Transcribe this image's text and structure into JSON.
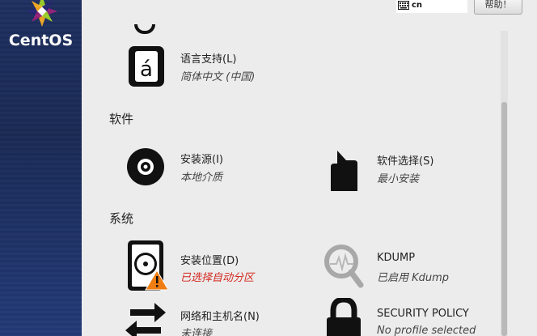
{
  "brand": {
    "name": "CentOS"
  },
  "topbar": {
    "keyboard_layout": "cn",
    "help_label": "帮助！"
  },
  "sections": {
    "software": "软件",
    "system": "系统"
  },
  "spokes": {
    "language": {
      "title": "语言支持(L)",
      "status": "简体中文 (中国)",
      "icon": "language-icon"
    },
    "install_source": {
      "title": "安装源(I)",
      "status": "本地介质",
      "icon": "disc-icon"
    },
    "software_selection": {
      "title": "软件选择(S)",
      "status": "最小安装",
      "icon": "package-icon"
    },
    "install_destination": {
      "title": "安装位置(D)",
      "status": "已选择自动分区",
      "icon": "hard-drive-warning-icon"
    },
    "kdump": {
      "title": "KDUMP",
      "status": "已启用 Kdump",
      "icon": "magnifier-icon"
    },
    "network": {
      "title": "网络和主机名(N)",
      "status": "未连接",
      "icon": "network-arrows-icon"
    },
    "security_policy": {
      "title": "SECURITY POLICY",
      "status": "No profile selected",
      "icon": "lock-icon"
    }
  },
  "colors": {
    "warning_text": "#d4271f",
    "sidebar": "#1f2f60"
  }
}
